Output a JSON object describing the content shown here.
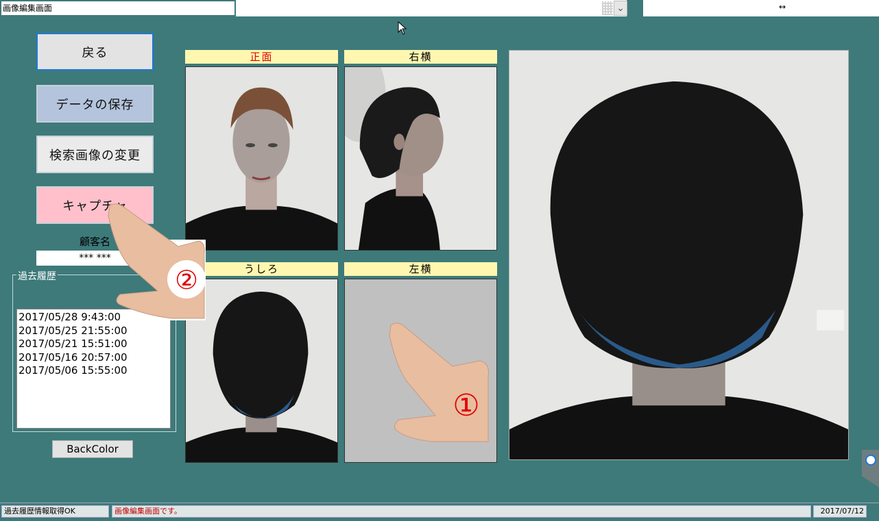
{
  "window": {
    "title": "画像編集画面",
    "resize_glyph": "↔",
    "dropdown_glyph": "⌄",
    "cursor_glyph": "➤"
  },
  "buttons": {
    "back": "戻る",
    "save": "データの保存",
    "change_search_image": "検索画像の変更",
    "capture": "キャプチャ",
    "backcolor": "BackColor"
  },
  "customer": {
    "label": "顧客名",
    "name": "*** ***"
  },
  "history": {
    "legend": "過去履歴",
    "items": [
      "2017/05/28 9:43:00",
      "2017/05/25 21:55:00",
      "2017/05/21 15:51:00",
      "2017/05/16 20:57:00",
      "2017/05/06 15:55:00"
    ]
  },
  "panels": {
    "front": "正面",
    "right": "右横",
    "back": "うしろ",
    "left": "左横"
  },
  "annotations": {
    "marker_1": "①",
    "marker_2": "②"
  },
  "status": {
    "left": "過去履歴情報取得OK",
    "message": "画像編集画面です。",
    "date": "2017/07/12"
  },
  "colors": {
    "background": "#3e7a7a",
    "panel_label_bg": "#fff7b0",
    "front_label": "#e00000",
    "capture_button": "#ffc0cb",
    "save_button": "#b4c4dc",
    "back_button_border": "#1e78d6",
    "status_message": "#c00000"
  }
}
